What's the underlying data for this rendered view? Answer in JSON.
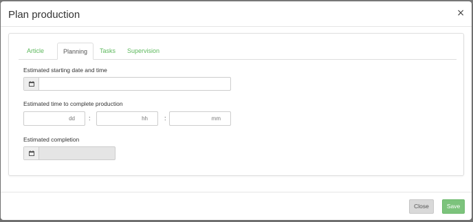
{
  "modal": {
    "title": "Plan production",
    "close_glyph": "×"
  },
  "tabs": [
    {
      "label": "Article",
      "active": false
    },
    {
      "label": "Planning",
      "active": true
    },
    {
      "label": "Tasks",
      "active": false
    },
    {
      "label": "Supervision",
      "active": false
    }
  ],
  "form": {
    "start_label": "Estimated starting date and time",
    "start_value": "",
    "duration_label": "Estimated time to complete production",
    "duration": {
      "days_unit": "dd",
      "hours_unit": "hh",
      "minutes_unit": "mm",
      "separator": ":"
    },
    "completion_label": "Estimated completion",
    "completion_value": ""
  },
  "footer": {
    "close_label": "Close",
    "save_label": "Save"
  },
  "colors": {
    "accent_green": "#5cb85c",
    "save_button": "#7cc37c",
    "close_button": "#d9d9d9"
  },
  "icons": [
    "close-icon",
    "calendar-icon"
  ]
}
